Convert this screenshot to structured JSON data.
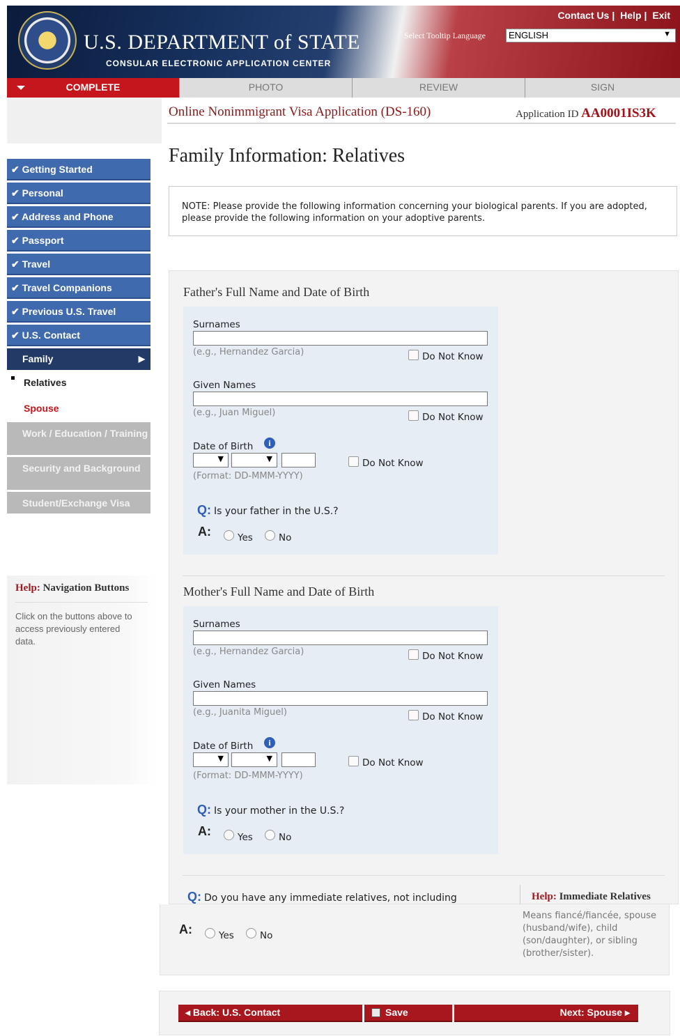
{
  "header": {
    "links": [
      "Contact Us",
      "Help",
      "Exit"
    ],
    "dept_title": "U.S. DEPARTMENT of STATE",
    "dept_subtitle": "CONSULAR ELECTRONIC APPLICATION CENTER",
    "tooltip_label": "Select Tooltip Language",
    "language": "ENGLISH"
  },
  "tabs": [
    "COMPLETE",
    "PHOTO",
    "REVIEW",
    "SIGN"
  ],
  "sidebar": {
    "done": [
      "Getting Started",
      "Personal",
      "Address and Phone",
      "Passport",
      "Travel",
      "Travel Companions",
      "Previous U.S. Travel",
      "U.S. Contact"
    ],
    "current": "Family",
    "subitems": [
      "Relatives",
      "Spouse"
    ],
    "disabled": [
      "Work / Education / Training",
      "Security and Background",
      "Student/Exchange Visa"
    ],
    "check": "✔",
    "help_prefix": "Help:",
    "help_title": "Navigation Buttons",
    "help_body": "Click on the buttons above to access previously entered data."
  },
  "main": {
    "app_name": "Online Nonimmigrant Visa Application (DS-160)",
    "app_id_label": "Application ID",
    "app_id": "AA0001IS3K",
    "page_title": "Family Information: Relatives",
    "note": "NOTE: Please provide the following information concerning your biological parents. If you are adopted, please provide the following information on your adoptive parents."
  },
  "father": {
    "section_title": "Father's Full Name and Date of Birth",
    "surnames_label": "Surnames",
    "surnames_hint": "(e.g., Hernandez Garcia)",
    "given_label": "Given Names",
    "given_hint": "(e.g., Juan Miguel)",
    "dob_label": "Date of Birth",
    "dob_hint": "(Format: DD-MMM-YYYY)",
    "question": "Is your father in the U.S.?"
  },
  "mother": {
    "section_title": "Mother's Full Name and Date of Birth",
    "surnames_label": "Surnames",
    "surnames_hint": "(e.g., Hernandez Garcia)",
    "given_label": "Given Names",
    "given_hint": "(e.g., Juanita Miguel)",
    "dob_label": "Date of Birth",
    "dob_hint": "(Format: DD-MMM-YYYY)",
    "question": "Is your mother in the U.S.?"
  },
  "common": {
    "do_not_know": "Do Not Know",
    "q": "Q:",
    "a": "A:",
    "yes": "Yes",
    "no": "No",
    "info": "i"
  },
  "relatives": {
    "question": "Do you have any immediate relatives, not including",
    "help_prefix": "Help:",
    "help_title": "Immediate Relatives",
    "help_body": "Means fiancé/fiancée, spouse (husband/wife), child (son/daughter), or sibling (brother/sister)."
  },
  "buttons": {
    "back": "◂ Back: U.S. Contact",
    "save": "Save",
    "next": "Next: Spouse ▸"
  }
}
